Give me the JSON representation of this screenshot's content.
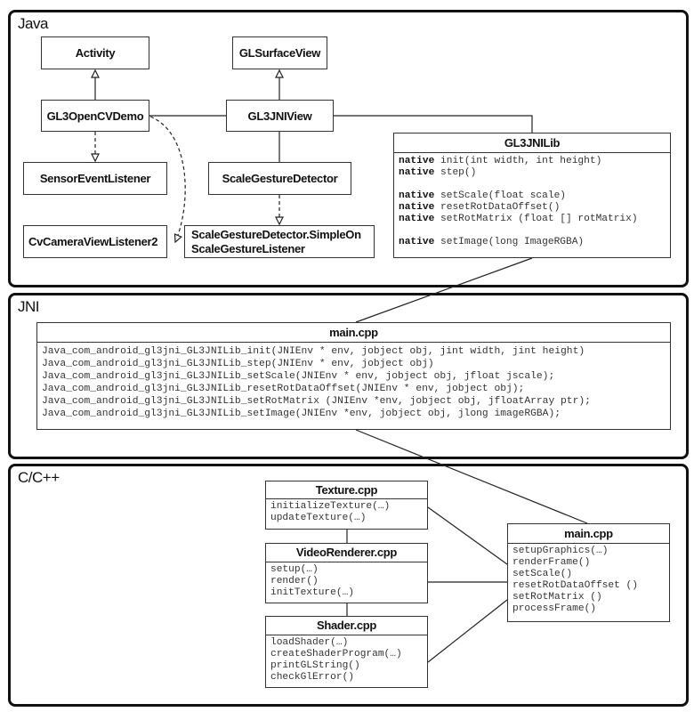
{
  "panels": {
    "java": "Java",
    "jni": "JNI",
    "cpp": "C/C++"
  },
  "java": {
    "activity": "Activity",
    "gl3opencvdemo": "GL3OpenCVDemo",
    "sensor": "SensorEventListener",
    "cvcamera": "CvCameraViewListener2",
    "glsurfaceview": "GLSurfaceView",
    "gl3jniview": "GL3JNIView",
    "scalegesture": "ScaleGestureDetector",
    "simpleon": "ScaleGestureDetector.SimpleOn",
    "simpleon2": "ScaleGestureListener",
    "gl3jnilib": {
      "title": "GL3JNILib",
      "keyword": "native",
      "methods": [
        "init(int width, int height)",
        "step()",
        "",
        "setScale(float scale)",
        "resetRotDataOffset()",
        "setRotMatrix (float [] rotMatrix)",
        "",
        "setImage(long ImageRGBA)"
      ]
    }
  },
  "jni": {
    "main": {
      "title": "main.cpp",
      "methods": [
        "Java_com_android_gl3jni_GL3JNILib_init(JNIEnv * env, jobject obj, jint width, jint height)",
        "Java_com_android_gl3jni_GL3JNILib_step(JNIEnv * env, jobject obj)",
        "Java_com_android_gl3jni_GL3JNILib_setScale(JNIEnv * env, jobject obj, jfloat jscale);",
        "Java_com_android_gl3jni_GL3JNILib_resetRotDataOffset(JNIEnv * env, jobject obj);",
        "Java_com_android_gl3jni_GL3JNILib_setRotMatrix (JNIEnv *env, jobject obj, jfloatArray ptr);",
        "Java_com_android_gl3jni_GL3JNILib_setImage(JNIEnv *env, jobject obj, jlong imageRGBA);"
      ]
    }
  },
  "cpp": {
    "texture": {
      "title": "Texture.cpp",
      "methods": [
        "initializeTexture(…)",
        "updateTexture(…)"
      ]
    },
    "video": {
      "title": "VideoRenderer.cpp",
      "methods": [
        "setup(…)",
        "render()",
        "initTexture(…)"
      ]
    },
    "shader": {
      "title": "Shader.cpp",
      "methods": [
        "loadShader(…)",
        "createShaderProgram(…)",
        "printGLString()",
        "checkGlError()"
      ]
    },
    "main": {
      "title": "main.cpp",
      "methods": [
        "setupGraphics(…)",
        "renderFrame()",
        "setScale()",
        "resetRotDataOffset ()",
        "setRotMatrix ()",
        "processFrame()"
      ]
    }
  }
}
